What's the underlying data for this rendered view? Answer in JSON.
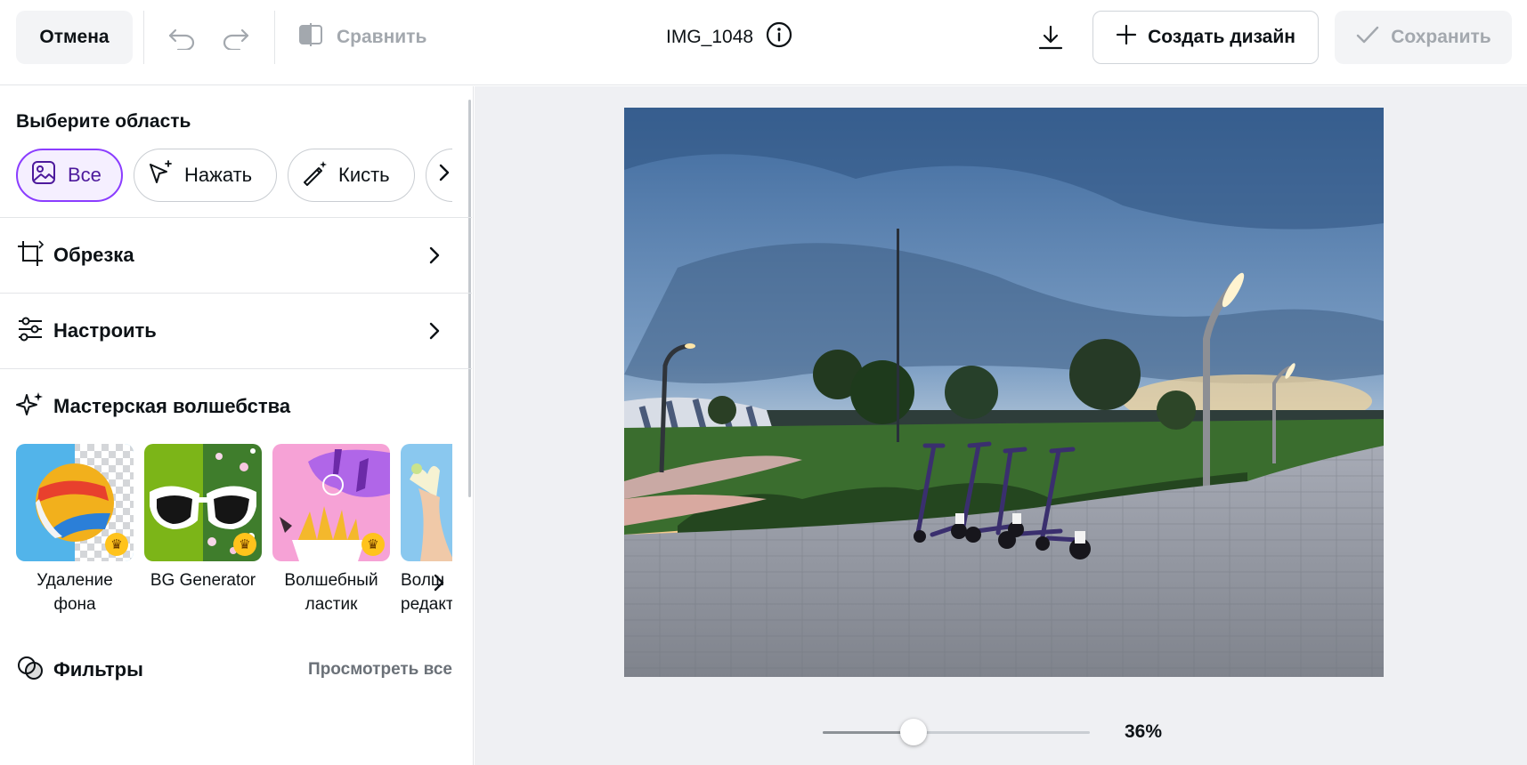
{
  "topbar": {
    "cancel_label": "Отмена",
    "compare_label": "Сравнить",
    "filename": "IMG_1048",
    "create_label": "Создать дизайн",
    "save_label": "Сохранить"
  },
  "panel": {
    "select_area_title": "Выберите область",
    "chips": [
      {
        "label": "Все",
        "icon": "image-icon",
        "active": true
      },
      {
        "label": "Нажать",
        "icon": "click-sparkle-icon",
        "active": false
      },
      {
        "label": "Кисть",
        "icon": "magic-brush-icon",
        "active": false
      }
    ],
    "crop_label": "Обрезка",
    "adjust_label": "Настроить",
    "magic_title": "Мастерская волшебства",
    "tools": [
      {
        "line1": "Удаление",
        "line2": "фона",
        "premium": true
      },
      {
        "line1": "BG Generator",
        "line2": "",
        "premium": true
      },
      {
        "line1": "Волшебный",
        "line2": "ластик",
        "premium": true
      },
      {
        "line1": "Волш",
        "line2": "редакт",
        "premium": false
      }
    ],
    "filters_label": "Фильтры",
    "view_all_label": "Просмотреть все"
  },
  "canvas": {
    "zoom_label": "36%",
    "zoom_fraction": 0.34
  },
  "colors": {
    "accent": "#8b3dff",
    "accent_bg": "#f5efff",
    "canvas_bg": "#eff0f3",
    "crown": "#ffc31c"
  }
}
